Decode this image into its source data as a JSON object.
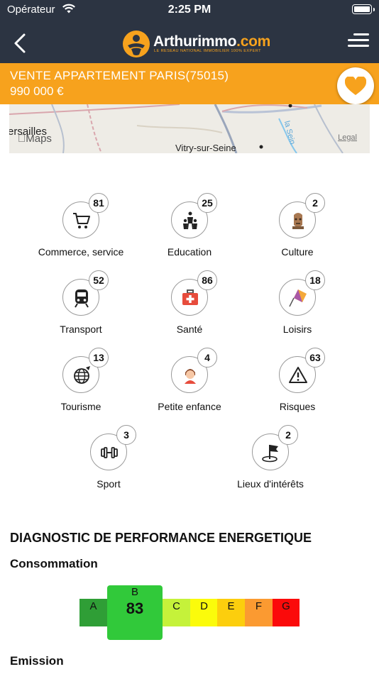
{
  "status": {
    "carrier": "Opérateur",
    "time": "2:25 PM"
  },
  "header": {
    "brand_main": "Arthurimmo",
    "brand_domain": ".com",
    "brand_tagline": "LE RESEAU NATIONAL IMMOBILIER 100% EXPERT"
  },
  "listing": {
    "title": "VENTE APPARTEMENT  PARIS(75015)",
    "price": "990 000 €"
  },
  "map": {
    "place1": "ersailles",
    "place2": "Vitry-sur-Seine",
    "attribution": "Maps",
    "legal": "Legal",
    "river": "la Sein"
  },
  "poi": [
    {
      "label": "Commerce, service",
      "count": "81",
      "icon": "cart-icon"
    },
    {
      "label": "Education",
      "count": "25",
      "icon": "family-icon"
    },
    {
      "label": "Culture",
      "count": "2",
      "icon": "statue-icon"
    },
    {
      "label": "Transport",
      "count": "52",
      "icon": "train-icon"
    },
    {
      "label": "Santé",
      "count": "86",
      "icon": "medical-kit-icon"
    },
    {
      "label": "Loisirs",
      "count": "18",
      "icon": "kite-icon"
    },
    {
      "label": "Tourisme",
      "count": "13",
      "icon": "globe-icon"
    },
    {
      "label": "Petite enfance",
      "count": "4",
      "icon": "child-icon"
    },
    {
      "label": "Risques",
      "count": "63",
      "icon": "warning-icon"
    },
    {
      "label": "Sport",
      "count": "3",
      "icon": "dumbbell-icon"
    },
    {
      "label": "Lieux d'intérêts",
      "count": "2",
      "icon": "flag-icon"
    }
  ],
  "dpe": {
    "title": "DIAGNOSTIC DE PERFORMANCE ENERGETIQUE",
    "consumption_title": "Consommation",
    "emission_title": "Emission",
    "scale": [
      {
        "cls": "A",
        "color": "#2f9e36"
      },
      {
        "cls": "B",
        "color": "#31c93a"
      },
      {
        "cls": "C",
        "color": "#c5f23a"
      },
      {
        "cls": "D",
        "color": "#fbfb0b"
      },
      {
        "cls": "E",
        "color": "#fcce0d"
      },
      {
        "cls": "F",
        "color": "#fb9a31"
      },
      {
        "cls": "G",
        "color": "#fb0a0a"
      }
    ],
    "current_class": "B",
    "current_value": "83"
  },
  "colors": {
    "navbar": "#2c3442",
    "accent": "#f7a21d"
  }
}
